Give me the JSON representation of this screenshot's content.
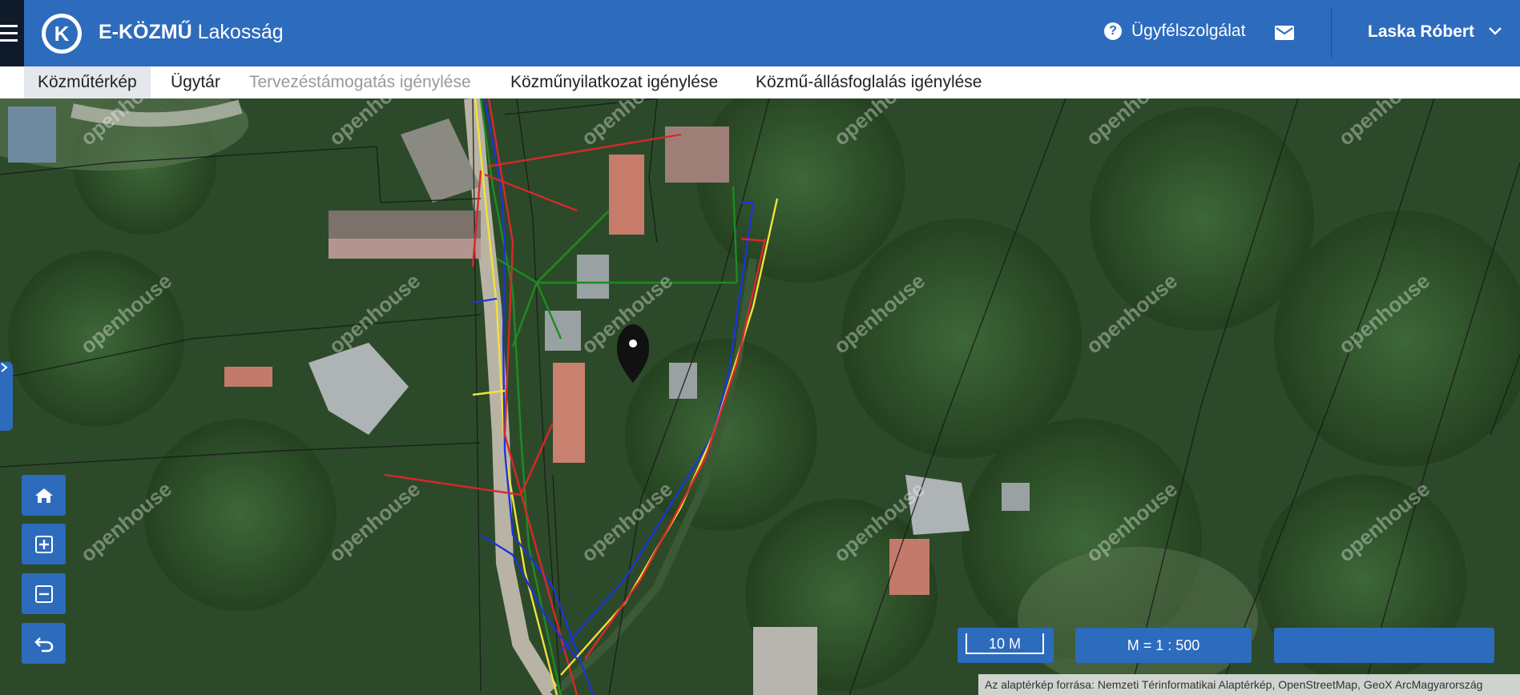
{
  "header": {
    "brand_bold": "E-KÖZMŰ",
    "brand_light": "Lakosság",
    "logo_letter": "K",
    "help_label": "Ügyfélszolgálat",
    "user_name": "Laska Róbert"
  },
  "tabs": [
    {
      "label": "Közműtérkép",
      "state": "active"
    },
    {
      "label": "Ügytár",
      "state": "normal"
    },
    {
      "label": "Tervezéstámogatás igénylése",
      "state": "disabled"
    },
    {
      "label": "Közműnyilatkozat igénylése",
      "state": "normal"
    },
    {
      "label": "Közmű-állásfoglalás igénylése",
      "state": "normal"
    }
  ],
  "map": {
    "controls": [
      "home-icon",
      "zoom-in-icon",
      "zoom-out-icon",
      "undo-icon"
    ],
    "scale_distance": "10 M",
    "scale_ratio": "M = 1 : 500",
    "attribution": "Az alaptérkép forrása: Nemzeti Térinformatikai Alaptérkép, OpenStreetMap, GeoX ArcMagyarország",
    "watermark": "openhouse",
    "marker": "location-pin-icon"
  },
  "colors": {
    "primary": "#2d6bbd",
    "header_dark": "#0f1a2b",
    "utility_red": "#d8282b",
    "utility_blue": "#1b35d8",
    "utility_yellow": "#f2e23a",
    "utility_green": "#1f8a24"
  }
}
